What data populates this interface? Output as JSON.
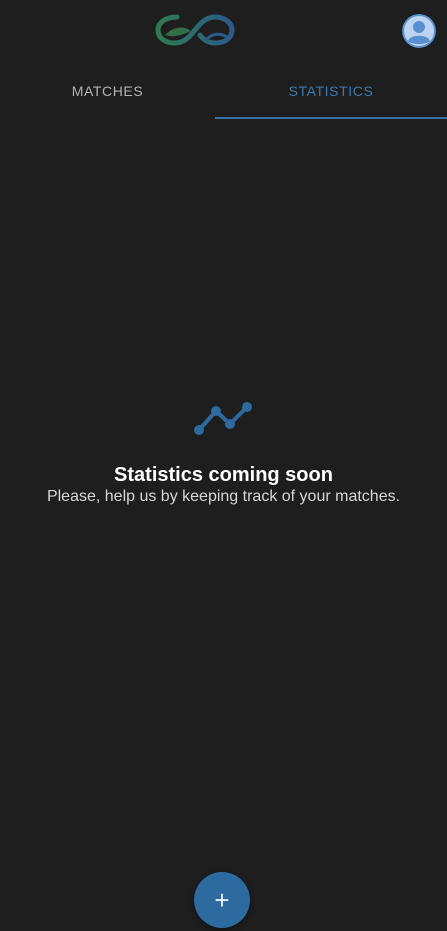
{
  "header": {
    "logo_icon": "infinity-leaf-logo",
    "avatar_icon": "user-avatar-icon"
  },
  "tabs": [
    {
      "label": "MATCHES",
      "selected": false
    },
    {
      "label": "STATISTICS",
      "selected": true
    }
  ],
  "empty_state": {
    "icon": "line-chart-icon",
    "title": "Statistics coming soon",
    "subtitle": "Please, help us by keeping track of your matches."
  },
  "fab": {
    "label": "+",
    "icon": "plus-icon"
  },
  "colors": {
    "background": "#1e1e1e",
    "accent": "#2d6aa0",
    "tab_active_text": "#3d78ae",
    "tab_inactive_text": "#b3b3b3"
  }
}
